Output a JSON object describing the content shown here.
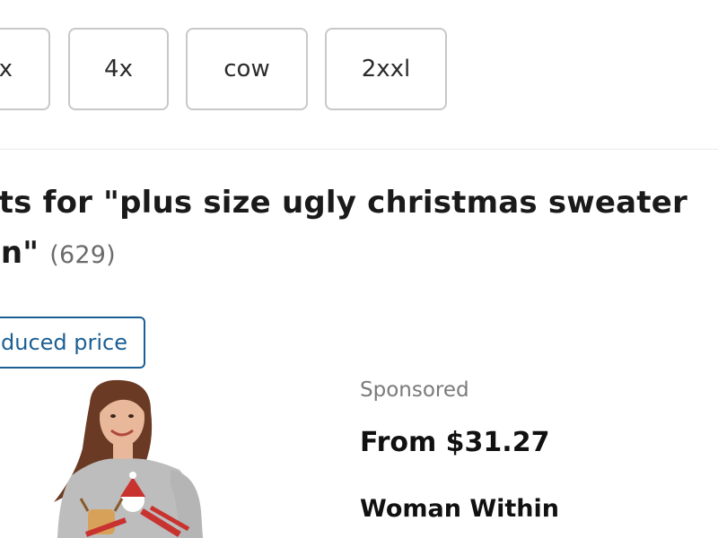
{
  "filters": {
    "chips": [
      {
        "label": "x"
      },
      {
        "label": "4x"
      },
      {
        "label": "cow"
      },
      {
        "label": "2xxl"
      }
    ]
  },
  "results": {
    "heading": "sults for \"plus size ugly christmas sweater",
    "heading_line2": "men\"",
    "count": "(629)"
  },
  "quick_filter": {
    "label": "duced price"
  },
  "product": {
    "sponsored_label": "Sponsored",
    "price": "From $31.27",
    "brand": "Woman Within",
    "image_icon": "woman-in-christmas-sweater-photo",
    "colors": {
      "sweater": "#bdbdbd",
      "hair": "#6b3a24",
      "skin": "#e9b89a",
      "accent_red": "#c8322f"
    }
  },
  "theme": {
    "link_blue": "#1b5f94"
  }
}
